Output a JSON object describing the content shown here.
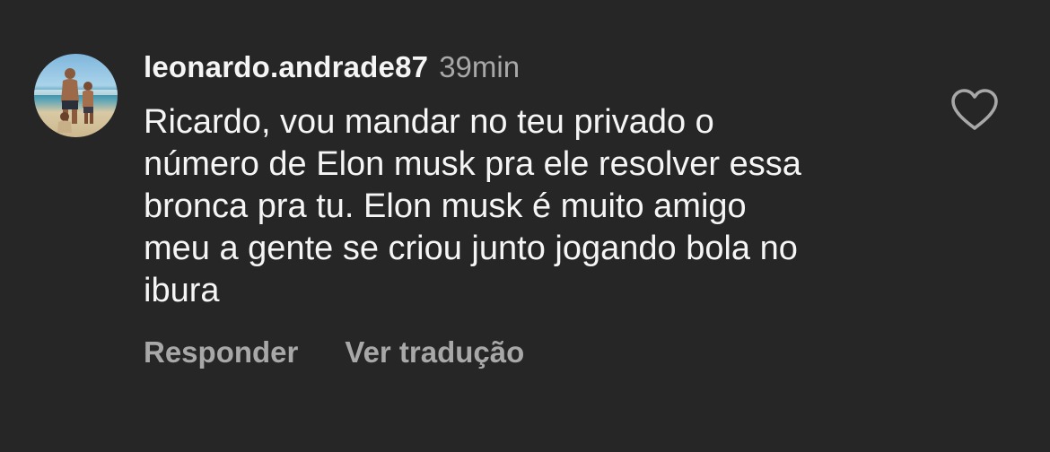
{
  "comment": {
    "username": "leonardo.andrade87",
    "time": "39min",
    "text_lines": [
      "Ricardo, vou mandar no teu privado o",
      "número de Elon musk pra ele resolver essa",
      "bronca pra tu. Elon musk é muito amigo",
      "meu a gente se criou junto jogando bola no",
      "ibura"
    ],
    "like_icon": "heart-outline-icon",
    "actions": {
      "reply_label": "Responder",
      "translate_label": "Ver tradução"
    }
  },
  "colors": {
    "background": "#262626",
    "primary_text": "#f5f5f5",
    "secondary_text": "#a8a8a8"
  }
}
